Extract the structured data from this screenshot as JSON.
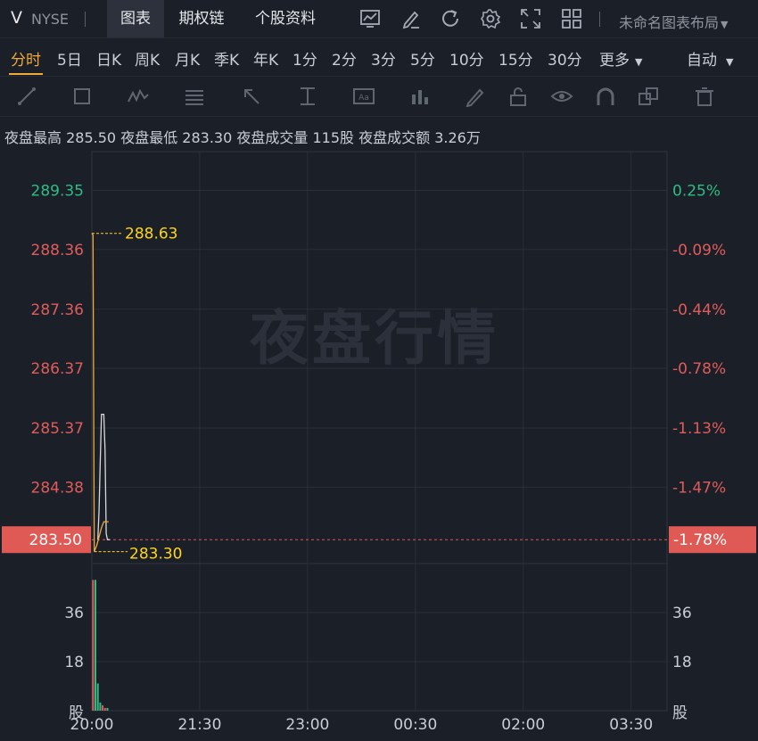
{
  "header": {
    "symbol": "V",
    "exchange": "NYSE",
    "tabs": [
      {
        "label": "图表",
        "active": true
      },
      {
        "label": "期权链"
      },
      {
        "label": "个股资料"
      }
    ],
    "icons": [
      "chart-style-icon",
      "draw-icon",
      "refresh-icon",
      "settings-icon",
      "fullscreen-icon",
      "grid-layout-icon"
    ],
    "layout_label": "未命名图表布局"
  },
  "periods": [
    "分时",
    "5日",
    "日K",
    "周K",
    "月K",
    "季K",
    "年K",
    "1分",
    "2分",
    "3分",
    "5分",
    "10分",
    "15分",
    "30分",
    "更多"
  ],
  "active_period": "分时",
  "auto_label": "自动",
  "draw_tools": [
    "line-tool-icon",
    "rect-tool-icon",
    "wave-tool-icon",
    "fib-tool-icon",
    "arrow-tool-icon",
    "measure-tool-icon",
    "text-tool-icon",
    "bar-tool-icon",
    "pen-tool-icon",
    "lock-icon",
    "eye-icon",
    "magnet-icon",
    "clone-icon",
    "trash-icon"
  ],
  "stats": {
    "high_label": "夜盘最高",
    "high": "285.50",
    "low_label": "夜盘最低",
    "low": "283.30",
    "vol_label": "夜盘成交量",
    "vol": "115股",
    "amt_label": "夜盘成交额",
    "amt": "3.26万"
  },
  "watermark": "夜盘行情",
  "colors": {
    "up": "#e05c5c",
    "down": "#2dbd85",
    "price_line": "#f0a93b",
    "avg_line": "#d7d9de",
    "marker": "#ffd51c",
    "current_bg": "#e05a55"
  },
  "chart_data": {
    "type": "line",
    "x_ticks": [
      "20:00",
      "21:30",
      "23:00",
      "00:30",
      "02:00",
      "03:30"
    ],
    "x_tick_minutes": [
      0,
      90,
      180,
      270,
      360,
      450
    ],
    "y_ticks_left": [
      {
        "label": "289.35",
        "value": 289.35
      },
      {
        "label": "288.36",
        "value": 288.36
      },
      {
        "label": "287.36",
        "value": 287.36
      },
      {
        "label": "286.37",
        "value": 286.37
      },
      {
        "label": "285.37",
        "value": 285.37
      },
      {
        "label": "284.38",
        "value": 284.38
      }
    ],
    "y_ticks_right": [
      {
        "label": "0.25%",
        "value": 289.35
      },
      {
        "label": "-0.09%",
        "value": 288.36
      },
      {
        "label": "-0.44%",
        "value": 287.36
      },
      {
        "label": "-0.78%",
        "value": 286.37
      },
      {
        "label": "-1.13%",
        "value": 285.37
      },
      {
        "label": "-1.47%",
        "value": 284.38
      }
    ],
    "ylim": [
      283.1,
      290.0
    ],
    "xlim_minutes": [
      0,
      480
    ],
    "current_price": {
      "label": "283.50",
      "value": 283.5,
      "pct": "-1.78%"
    },
    "max_marker": {
      "label": "288.63",
      "value": 288.63
    },
    "min_marker": {
      "label": "283.30",
      "value": 283.3
    },
    "series": [
      {
        "points": [
          [
            0,
            288.63
          ],
          [
            1,
            288.6
          ],
          [
            2,
            283.3
          ],
          [
            3,
            283.35
          ],
          [
            4,
            283.4
          ],
          [
            6,
            283.55
          ],
          [
            8,
            283.7
          ],
          [
            10,
            283.8
          ],
          [
            12,
            283.8
          ],
          [
            14,
            283.8
          ]
        ]
      },
      {
        "points": [
          [
            5,
            283.5
          ],
          [
            6,
            284.0
          ],
          [
            7,
            284.8
          ],
          [
            8,
            285.6
          ],
          [
            9,
            285.6
          ],
          [
            10,
            285.6
          ],
          [
            11,
            285.0
          ],
          [
            12,
            283.6
          ],
          [
            13,
            283.5
          ],
          [
            15,
            283.5
          ]
        ]
      }
    ],
    "volume": {
      "ticks": [
        {
          "label": "36",
          "value": 36
        },
        {
          "label": "18",
          "value": 18
        }
      ],
      "unit_label": "股",
      "ylim": [
        0,
        54
      ],
      "bars": [
        {
          "x": 1,
          "v": 48,
          "dir": "up"
        },
        {
          "x": 3,
          "v": 48,
          "dir": "down"
        },
        {
          "x": 5,
          "v": 10,
          "dir": "down"
        },
        {
          "x": 7,
          "v": 3,
          "dir": "down"
        },
        {
          "x": 9,
          "v": 2,
          "dir": "up"
        },
        {
          "x": 11,
          "v": 1,
          "dir": "up"
        },
        {
          "x": 13,
          "v": 1,
          "dir": "down"
        }
      ]
    }
  }
}
